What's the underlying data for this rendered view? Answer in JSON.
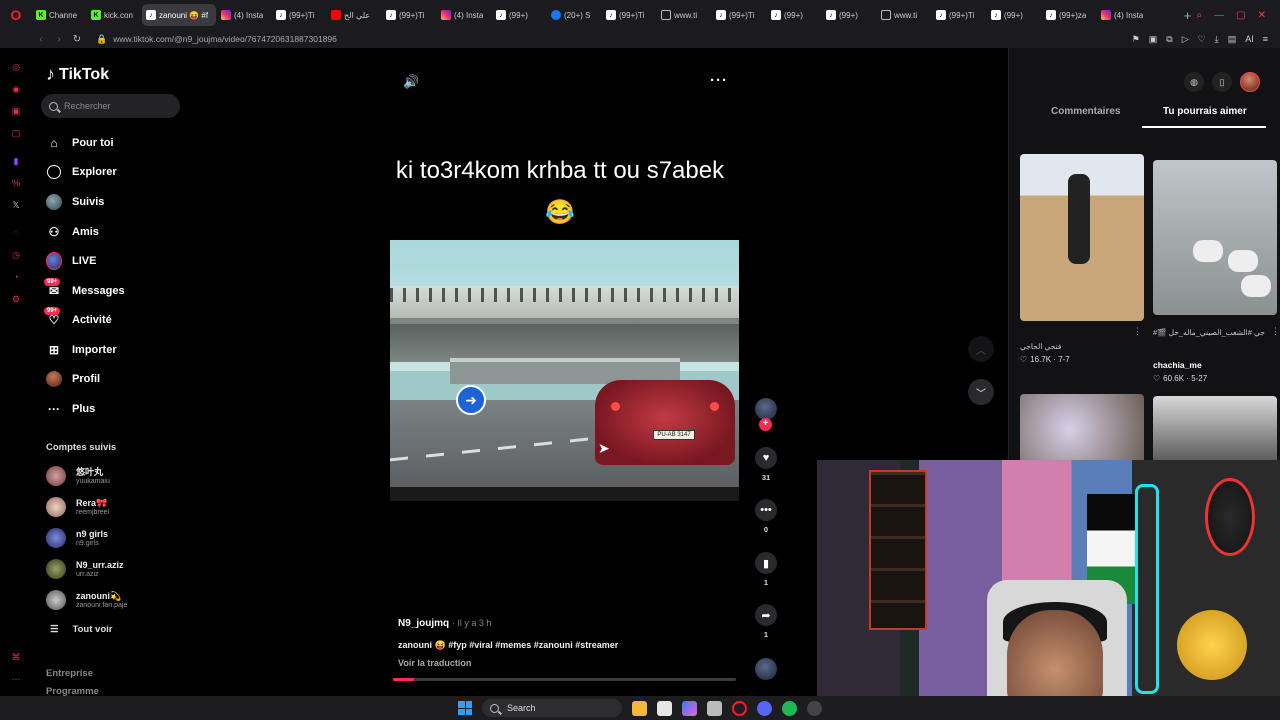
{
  "browser": {
    "tabs": [
      {
        "label": "Channe",
        "icon": "kick-icon",
        "active": false
      },
      {
        "label": "kick.con",
        "icon": "kick-icon",
        "active": false
      },
      {
        "label": "zanouni 😝 #f",
        "icon": "tiktok-icon",
        "active": true
      },
      {
        "label": "(4) Insta",
        "icon": "instagram-icon",
        "active": false
      },
      {
        "label": "(99+)Ti",
        "icon": "tiktok-icon",
        "active": false
      },
      {
        "label": "علي الح",
        "icon": "youtube-icon",
        "active": false
      },
      {
        "label": "(99+)Ti",
        "icon": "tiktok-icon",
        "active": false
      },
      {
        "label": "(4) Insta",
        "icon": "instagram-icon",
        "active": false
      },
      {
        "label": "(99+)",
        "icon": "tiktok-icon",
        "active": false
      },
      {
        "label": "(20+) S",
        "icon": "facebook-icon",
        "active": false
      },
      {
        "label": "(99+)Ti",
        "icon": "tiktok-icon",
        "active": false
      },
      {
        "label": "www.ti",
        "icon": "page-icon",
        "active": false
      },
      {
        "label": "(99+)Ti",
        "icon": "tiktok-icon",
        "active": false
      },
      {
        "label": "(99+)",
        "icon": "tiktok-icon",
        "active": false
      },
      {
        "label": "(99+)",
        "icon": "tiktok-icon",
        "active": false
      },
      {
        "label": "www.ti",
        "icon": "page-icon",
        "active": false
      },
      {
        "label": "(99+)Ti",
        "icon": "tiktok-icon",
        "active": false
      },
      {
        "label": "(99+)",
        "icon": "tiktok-icon",
        "active": false
      },
      {
        "label": "(99+)za",
        "icon": "tiktok-icon",
        "active": false
      },
      {
        "label": "(4) Insta",
        "icon": "instagram-icon",
        "active": false
      }
    ],
    "url": "www.tiktok.com/@n9_joujma/video/7674720631887301896",
    "address_right": "AI"
  },
  "tiktok": {
    "logo": "TikTok",
    "search_placeholder": "Rechercher",
    "nav": [
      {
        "label": "Pour toi",
        "icon": "home-icon"
      },
      {
        "label": "Explorer",
        "icon": "compass-icon"
      },
      {
        "label": "Suivis",
        "icon": "following-icon"
      },
      {
        "label": "Amis",
        "icon": "friends-icon"
      },
      {
        "label": "LIVE",
        "icon": "live-icon"
      },
      {
        "label": "Messages",
        "icon": "messages-icon",
        "badge": "99+"
      },
      {
        "label": "Activité",
        "icon": "activity-icon",
        "badge": "99+"
      },
      {
        "label": "Importer",
        "icon": "upload-icon"
      },
      {
        "label": "Profil",
        "icon": "profile-icon"
      },
      {
        "label": "Plus",
        "icon": "more-icon"
      }
    ],
    "following_title": "Comptes suivis",
    "following": [
      {
        "name": "悠叶丸",
        "handle": "yuukamaiu"
      },
      {
        "name": "Rera🎀",
        "handle": "reemjbreel"
      },
      {
        "name": "n9 girls",
        "handle": "n9.girls"
      },
      {
        "name": "N9_urr.aziz",
        "handle": "urr.aziz"
      },
      {
        "name": "zanouni💫",
        "handle": "zanouni.fan.paje"
      }
    ],
    "see_all": "Tout voir",
    "footer": [
      "Entreprise",
      "Programme"
    ]
  },
  "video": {
    "caption": "ki to3r4kom krhba tt ou s7abek 😂",
    "plate": "PU-AB 3147",
    "author": "N9_joujmq",
    "time": "· Il y a 3 h",
    "description": "zanouni 😝 #fyp #viral #memes #zanouni #streamer",
    "translate": "Voir la traduction",
    "progress": 0.06,
    "likes": "31",
    "comments": "0",
    "saves": "1",
    "shares": "1"
  },
  "panel": {
    "tab_comments": "Commentaires",
    "tab_suggestions": "Tu pourrais aimer",
    "cards": [
      {
        "caption": "فتحي الحاجي",
        "stat": "16.7K · 7-7"
      },
      {
        "caption": "#🎬 مولتاجي #الشعب_الصيني_ماله_حل🤣",
        "user": "chachia_me",
        "stat": "60.6K · 5-27"
      }
    ]
  },
  "taskbar": {
    "search": "Search"
  },
  "colors": {
    "accent": "#fe2c55",
    "opera_red": "#ff1b2d"
  }
}
